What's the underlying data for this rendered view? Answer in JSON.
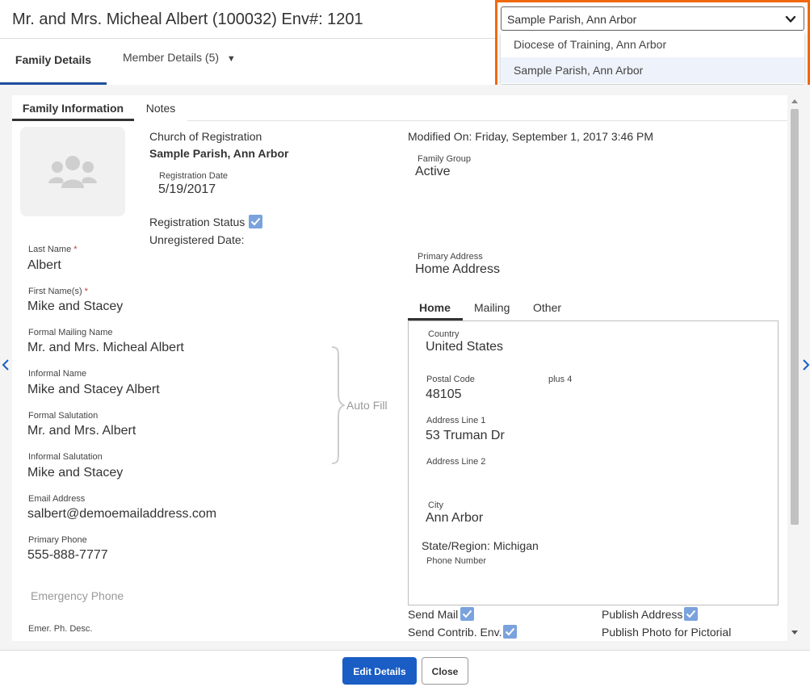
{
  "header": {
    "title": "Mr. and Mrs. Micheal Albert (100032) Env#: 1201",
    "parish_select": {
      "value": "Sample Parish, Ann Arbor",
      "options": [
        "Diocese of Training, Ann Arbor",
        "Sample Parish, Ann Arbor"
      ],
      "highlight_color": "#f0690f"
    }
  },
  "tabs": {
    "family_details": "Family Details",
    "member_details": "Member Details (5)",
    "member_caret": "▼"
  },
  "subtabs": {
    "family_information": "Family Information",
    "notes": "Notes"
  },
  "registration": {
    "church_label": "Church of Registration",
    "church_value": "Sample Parish, Ann Arbor",
    "date_label": "Registration Date",
    "date_value": "5/19/2017",
    "status_label": "Registration Status",
    "status_checked": true,
    "unregistered_label": "Unregistered Date:"
  },
  "fields": {
    "last_name": {
      "label": "Last Name",
      "value": "Albert"
    },
    "first_names": {
      "label": "First Name(s)",
      "value": "Mike and Stacey"
    },
    "formal_mailing_name": {
      "label": "Formal Mailing Name",
      "value": "Mr. and Mrs. Micheal Albert"
    },
    "informal_name": {
      "label": "Informal Name",
      "value": "Mike and Stacey Albert"
    },
    "formal_salutation": {
      "label": "Formal Salutation",
      "value": "Mr. and Mrs. Albert"
    },
    "informal_salutation": {
      "label": "Informal Salutation",
      "value": "Mike and Stacey"
    },
    "email": {
      "label": "Email Address",
      "value": "salbert@demoemailaddress.com"
    },
    "primary_phone": {
      "label": "Primary Phone",
      "value": "555-888-7777"
    },
    "emergency_phone_placeholder": "Emergency Phone",
    "emer_ph_desc": {
      "label": "Emer. Ph. Desc."
    },
    "required_marker": "*"
  },
  "auto_fill": "Auto Fill",
  "right": {
    "modified_label": "Modified On:",
    "modified_value": "Friday, September 1, 2017 3:46 PM",
    "family_group_label": "Family Group",
    "family_group_value": "Active",
    "primary_address_label": "Primary Address",
    "primary_address_value": "Home Address"
  },
  "address_tabs": {
    "home": "Home",
    "mailing": "Mailing",
    "other": "Other"
  },
  "address": {
    "country_label": "Country",
    "country_value": "United States",
    "postal_label": "Postal Code",
    "postal_value": "48105",
    "plus4_label": "plus 4",
    "line1_label": "Address Line 1",
    "line1_value": "53 Truman Dr",
    "line2_label": "Address Line 2",
    "city_label": "City",
    "city_value": "Ann Arbor",
    "state_label": "State/Region:",
    "state_value": "Michigan",
    "phone_label": "Phone Number"
  },
  "flags": {
    "send_mail": {
      "label": "Send Mail",
      "checked": true
    },
    "send_contrib_env": {
      "label": "Send Contrib. Env.",
      "checked": true
    },
    "publish_address": {
      "label": "Publish Address",
      "checked": true
    },
    "publish_photo": {
      "label": "Publish Photo for Pictorial"
    }
  },
  "footer": {
    "edit": "Edit Details",
    "close": "Close"
  },
  "colors": {
    "primary": "#1a5dc4",
    "checkbox": "#7aa2dd"
  }
}
